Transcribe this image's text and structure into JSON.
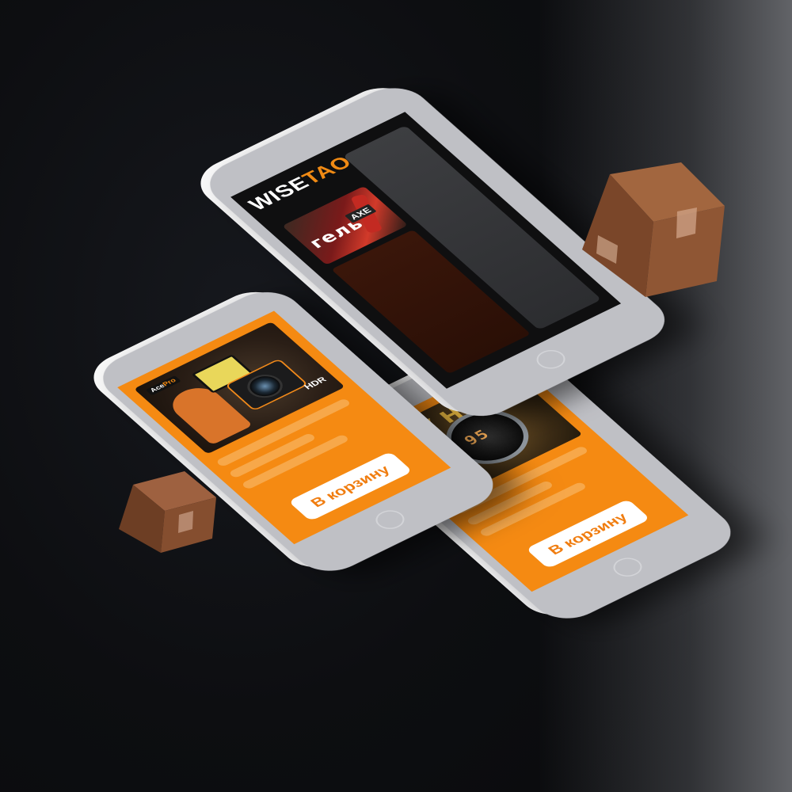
{
  "brand": {
    "part1": "WISE",
    "part2": "TAO"
  },
  "promo_banner": {
    "headline": "гель",
    "brand_tag": "AXE"
  },
  "products": [
    {
      "model_part1": "Ace",
      "model_part2": "Pro",
      "feature": "HDR",
      "cart_label": "В корзину"
    },
    {
      "display_digits": "95",
      "headline": "НАУ НИК",
      "cart_label": "В корзину"
    }
  ],
  "colors": {
    "accent_orange": "#f58a12",
    "button_text": "#f07d10",
    "dark_screen": "#0f0f10",
    "box_brown": "#8a5434"
  },
  "icons": [
    "cardboard-box-icon",
    "home-button-icon"
  ]
}
